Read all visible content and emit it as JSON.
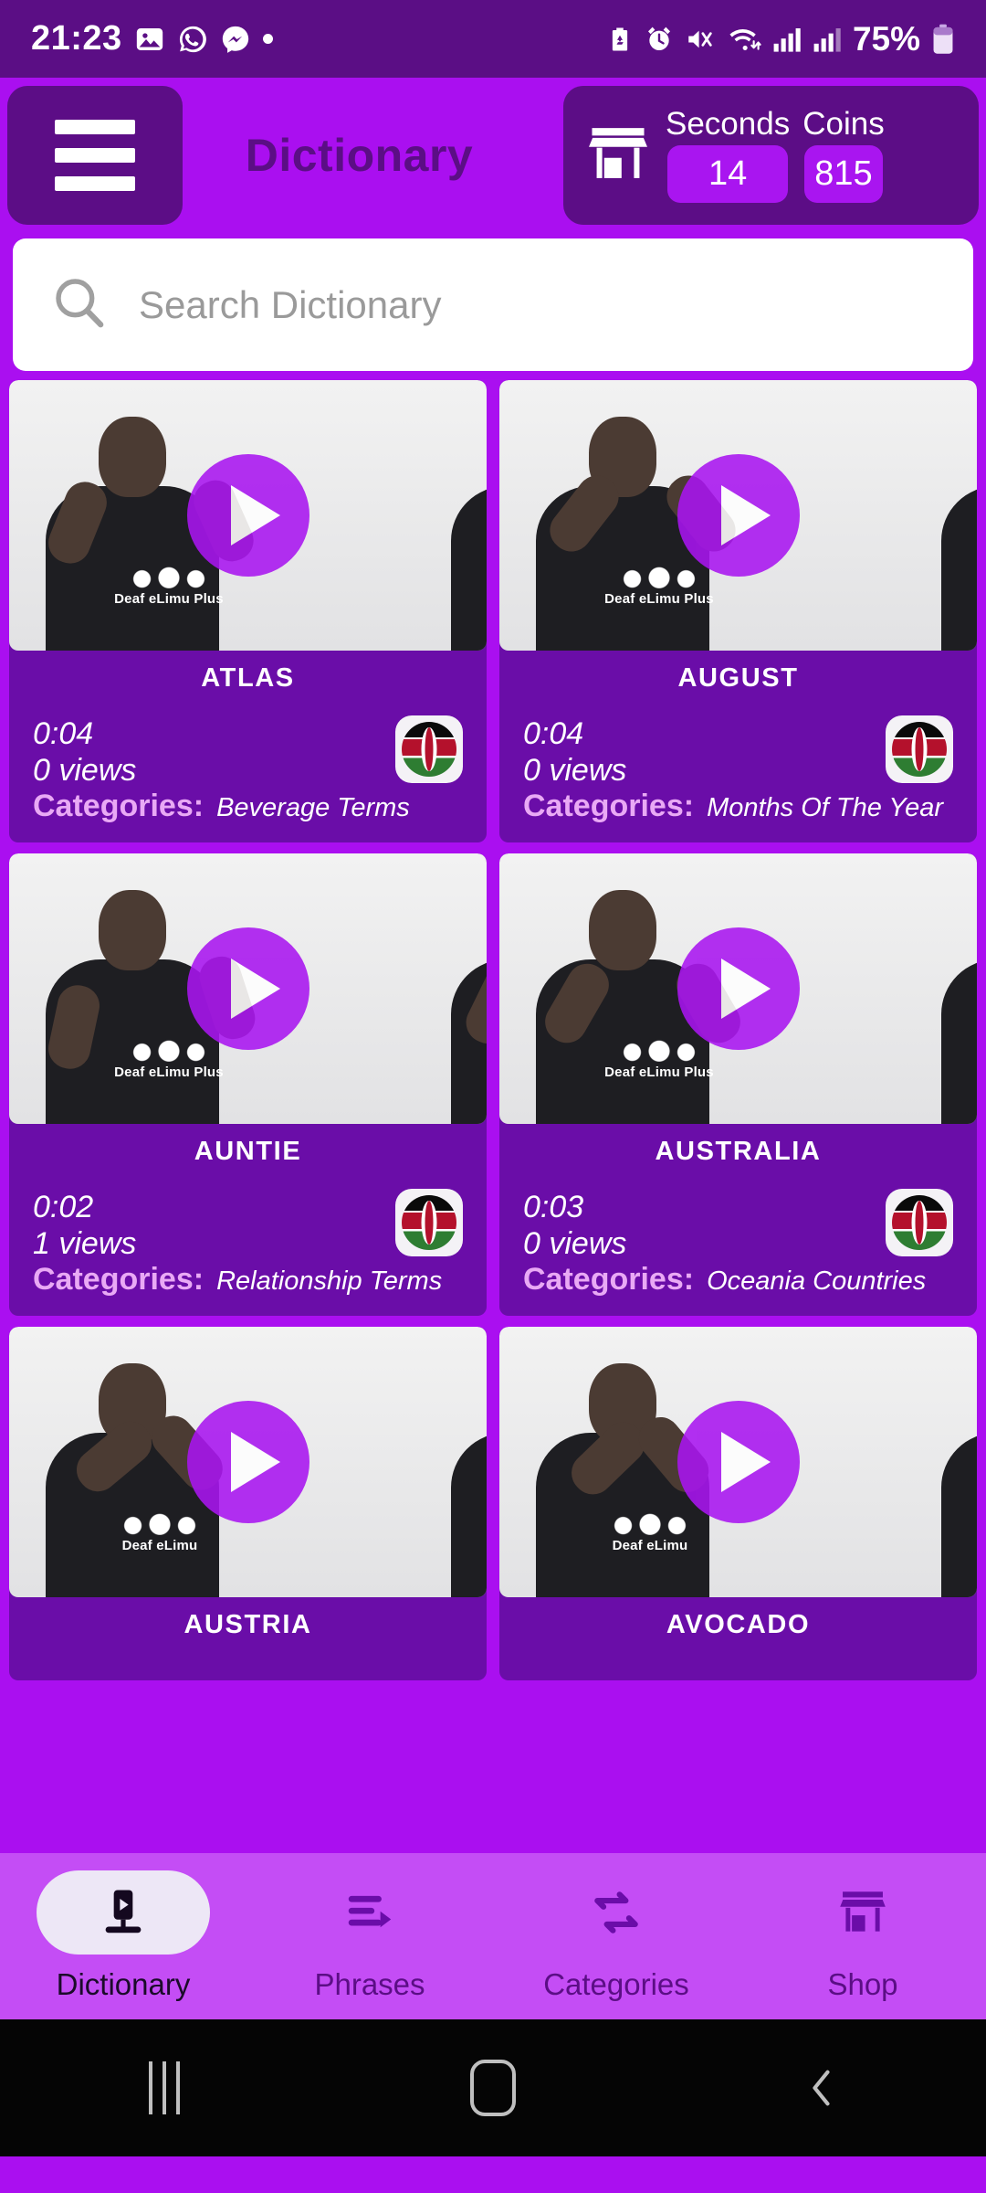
{
  "status_bar": {
    "time": "21:23",
    "left_icons": [
      "gallery-icon",
      "whatsapp-icon",
      "messenger-icon",
      "dot-icon"
    ],
    "right_icons": [
      "battery-saver-icon",
      "alarm-icon",
      "mute-vibrate-icon",
      "wifi-icon",
      "signal-bars-icon",
      "signal-bars-2-icon"
    ],
    "battery_percent": "75%",
    "background_color": "#5B0E85"
  },
  "header": {
    "menu_icon": "hamburger-menu-icon",
    "title": "Dictionary",
    "shop_icon": "store-icon",
    "seconds_label": "Seconds",
    "seconds_value": "14",
    "coins_label": "Coins",
    "coins_value": "815",
    "background_color": "#AA0FF0",
    "panel_color": "#5C0D86",
    "badge_color": "#A915F0",
    "title_color": "#5B0E85"
  },
  "search": {
    "icon": "search-icon",
    "placeholder": "Search Dictionary",
    "value": ""
  },
  "cards": [
    {
      "title": "ATLAS",
      "duration": "0:04",
      "views": "0 views",
      "categories_label": "Categories:",
      "category": "Beverage Terms",
      "flag": "kenya-flag-icon",
      "play_icon": "play-button-icon",
      "shirt_text": "Deaf eLimu Plus"
    },
    {
      "title": "AUGUST",
      "duration": "0:04",
      "views": "0 views",
      "categories_label": "Categories:",
      "category": "Months Of The Year",
      "flag": "kenya-flag-icon",
      "play_icon": "play-button-icon",
      "shirt_text": "Deaf eLimu Plus"
    },
    {
      "title": "AUNTIE",
      "duration": "0:02",
      "views": "1 views",
      "categories_label": "Categories:",
      "category": "Relationship Terms",
      "flag": "kenya-flag-icon",
      "play_icon": "play-button-icon",
      "shirt_text": "Deaf eLimu Plus"
    },
    {
      "title": "AUSTRALIA",
      "duration": "0:03",
      "views": "0 views",
      "categories_label": "Categories:",
      "category": "Oceania Countries",
      "flag": "kenya-flag-icon",
      "play_icon": "play-button-icon",
      "shirt_text": "Deaf eLimu Plus"
    },
    {
      "title": "AUSTRIA",
      "duration": "",
      "views": "",
      "categories_label": "",
      "category": "",
      "flag": "kenya-flag-icon",
      "play_icon": "play-button-icon",
      "shirt_text": "Deaf eLimu"
    },
    {
      "title": "AVOCADO",
      "duration": "",
      "views": "",
      "categories_label": "",
      "category": "",
      "flag": "kenya-flag-icon",
      "play_icon": "play-button-icon",
      "shirt_text": "Deaf eLimu"
    }
  ],
  "bottom_nav": {
    "background_color": "#C44DF5",
    "items": [
      {
        "label": "Dictionary",
        "icon": "video-library-icon",
        "active": true
      },
      {
        "label": "Phrases",
        "icon": "phrases-list-icon",
        "active": false
      },
      {
        "label": "Categories",
        "icon": "shuffle-arrows-icon",
        "active": false
      },
      {
        "label": "Shop",
        "icon": "store-icon",
        "active": false
      }
    ]
  },
  "android_nav": {
    "recents": "recents-icon",
    "home": "home-icon",
    "back": "back-icon"
  }
}
